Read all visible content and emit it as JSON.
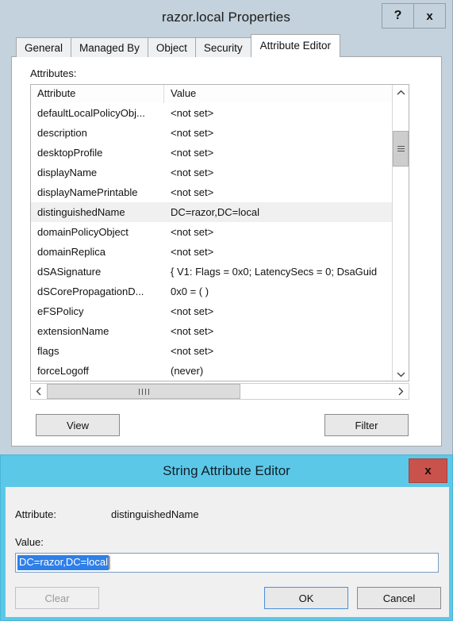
{
  "window": {
    "title": "razor.local Properties",
    "help_button": "?",
    "close_button": "x"
  },
  "tabs": [
    {
      "label": "General",
      "active": false
    },
    {
      "label": "Managed By",
      "active": false
    },
    {
      "label": "Object",
      "active": false
    },
    {
      "label": "Security",
      "active": false
    },
    {
      "label": "Attribute Editor",
      "active": true
    }
  ],
  "attribute_editor": {
    "section_label": "Attributes:",
    "columns": [
      "Attribute",
      "Value"
    ],
    "rows": [
      {
        "attribute": "defaultLocalPolicyObj...",
        "value": "<not set>",
        "selected": false
      },
      {
        "attribute": "description",
        "value": "<not set>",
        "selected": false
      },
      {
        "attribute": "desktopProfile",
        "value": "<not set>",
        "selected": false
      },
      {
        "attribute": "displayName",
        "value": "<not set>",
        "selected": false
      },
      {
        "attribute": "displayNamePrintable",
        "value": "<not set>",
        "selected": false
      },
      {
        "attribute": "distinguishedName",
        "value": "DC=razor,DC=local",
        "selected": true
      },
      {
        "attribute": "domainPolicyObject",
        "value": "<not set>",
        "selected": false
      },
      {
        "attribute": "domainReplica",
        "value": "<not set>",
        "selected": false
      },
      {
        "attribute": "dSASignature",
        "value": "{ V1: Flags = 0x0; LatencySecs = 0; DsaGuid",
        "selected": false
      },
      {
        "attribute": "dSCorePropagationD...",
        "value": "0x0 = ( )",
        "selected": false
      },
      {
        "attribute": "eFSPolicy",
        "value": "<not set>",
        "selected": false
      },
      {
        "attribute": "extensionName",
        "value": "<not set>",
        "selected": false
      },
      {
        "attribute": "flags",
        "value": "<not set>",
        "selected": false
      },
      {
        "attribute": "forceLogoff",
        "value": "(never)",
        "selected": false
      }
    ],
    "view_button": "View",
    "filter_button": "Filter"
  },
  "string_editor": {
    "title": "String Attribute Editor",
    "close_button": "x",
    "attribute_label": "Attribute:",
    "attribute_name": "distinguishedName",
    "value_label": "Value:",
    "value_text": "DC=razor,DC=local",
    "clear_button": "Clear",
    "ok_button": "OK",
    "cancel_button": "Cancel"
  },
  "colors": {
    "window_chrome": "#c3d2dc",
    "dialog_title": "#5cc8e8",
    "dialog_close": "#c9524c",
    "selection": "#2f7fe8",
    "focus_border": "#4a90d9"
  }
}
